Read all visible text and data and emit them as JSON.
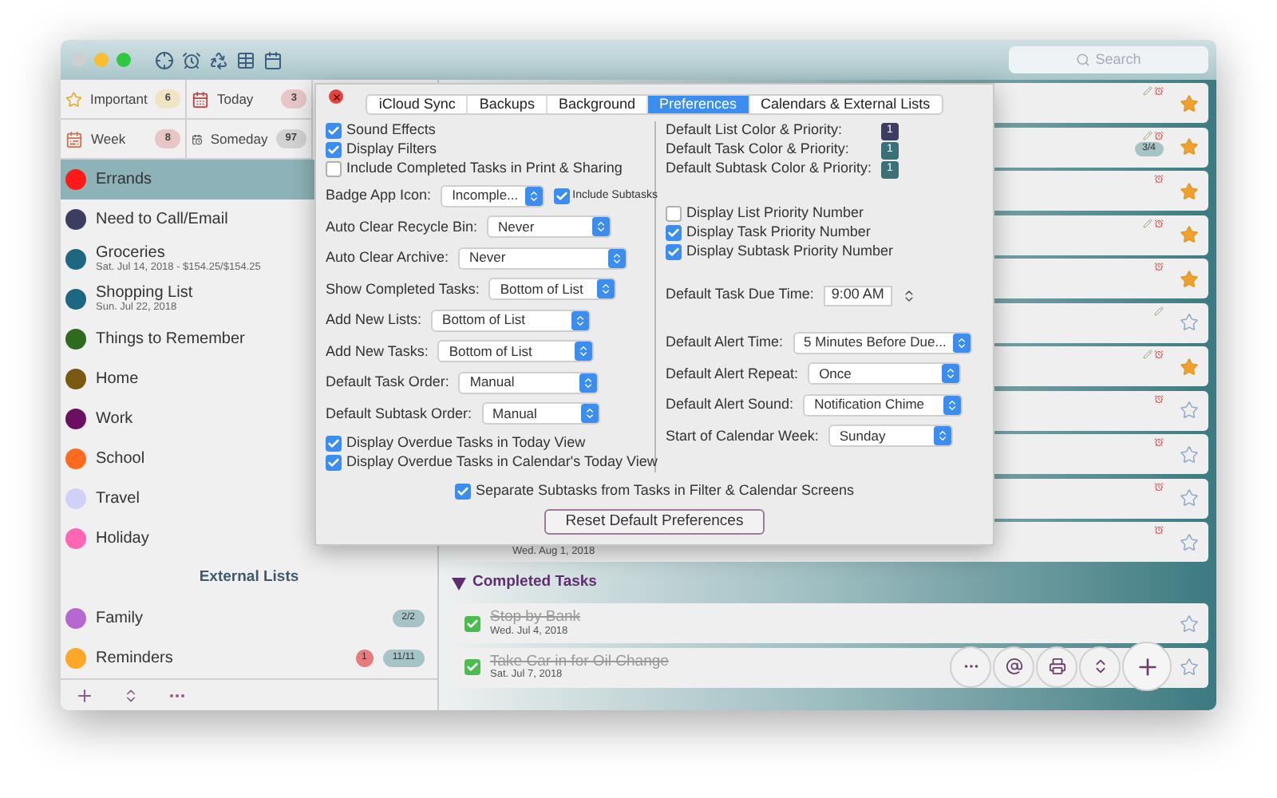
{
  "toolbar": {
    "search": {
      "placeholder": "Search"
    }
  },
  "filters": [
    {
      "label": "Important",
      "count": "6",
      "color": "#efe5c4"
    },
    {
      "label": "Today",
      "count": "3",
      "color": "#e8c6c6"
    },
    {
      "label": "Week",
      "count": "8",
      "color": "#e8c6c6"
    },
    {
      "label": "Someday",
      "count": "97",
      "color": "#d2d2d2"
    }
  ],
  "lists": [
    {
      "name": "Errands",
      "color": "#ff1a1a",
      "selected": true
    },
    {
      "name": "Need to Call/Email",
      "color": "#3d3d63",
      "selected": false
    },
    {
      "name": "Groceries",
      "subtitle": "Sat. Jul 14, 2018 - $154.25/$154.25",
      "color": "#1d6780",
      "selected": false
    },
    {
      "name": "Shopping List",
      "subtitle": "Sun. Jul 22, 2018",
      "color": "#1d6780",
      "selected": false
    },
    {
      "name": "Things to Remember",
      "color": "#2f6b1f",
      "selected": false
    },
    {
      "name": "Home",
      "color": "#7a5a12",
      "selected": false
    },
    {
      "name": "Work",
      "color": "#6b1060",
      "selected": false
    },
    {
      "name": "School",
      "color": "#ff6a20",
      "selected": false
    },
    {
      "name": "Travel",
      "color": "#d0d0f8",
      "selected": false
    },
    {
      "name": "Holiday",
      "color": "#ff66b3",
      "selected": false
    }
  ],
  "external_lists": {
    "heading": "External Lists",
    "items": [
      {
        "name": "Family",
        "color": "#b667d0",
        "progress": "2/2",
        "selected": false
      },
      {
        "name": "Reminders",
        "color": "#ffa726",
        "alert": "1",
        "progress": "11/11",
        "selected": false
      }
    ]
  },
  "tasks": [
    {
      "starred": true,
      "alarm": true,
      "note": true
    },
    {
      "starred": true,
      "alarm": true,
      "note": true,
      "progress": "3/4"
    },
    {
      "starred": true,
      "alarm": true,
      "note": false
    },
    {
      "starred": true,
      "alarm": true,
      "note": true
    },
    {
      "starred": true,
      "alarm": true,
      "note": false
    },
    {
      "starred": false,
      "alarm": false,
      "note": true
    },
    {
      "starred": true,
      "alarm": true,
      "note": true
    },
    {
      "starred": false,
      "alarm": true,
      "note": false
    },
    {
      "starred": false,
      "alarm": true,
      "note": false
    },
    {
      "starred": false,
      "alarm": true,
      "note": false
    },
    {
      "starred": false,
      "alarm": true,
      "note": false,
      "date": "Wed. Aug 1, 2018"
    }
  ],
  "completed": {
    "heading": "Completed Tasks",
    "expanded": true,
    "tasks": [
      {
        "title": "Stop by Bank",
        "date": "Wed. Jul 4, 2018",
        "checked": true,
        "starred": false
      },
      {
        "title": "Take Car in for Oil Change",
        "date": "Sat. Jul 7, 2018",
        "checked": true,
        "starred": false
      }
    ]
  },
  "dialog": {
    "tabs": [
      {
        "label": "iCloud Sync",
        "selected": false
      },
      {
        "label": "Backups",
        "selected": false
      },
      {
        "label": "Background",
        "selected": false
      },
      {
        "label": "Preferences",
        "selected": true
      },
      {
        "label": "Calendars & External Lists",
        "selected": false
      }
    ],
    "left_checks": [
      {
        "label": "Sound Effects",
        "checked": true
      },
      {
        "label": "Display Filters",
        "checked": true
      },
      {
        "label": "Include Completed Tasks in Print & Sharing",
        "checked": false
      }
    ],
    "badge": {
      "label": "Badge App Icon:",
      "value": "Incomple...",
      "option": {
        "label": "Include Subtasks",
        "checked": true
      }
    },
    "left_selects": [
      {
        "label": "Auto Clear Recycle Bin:",
        "value": "Never"
      },
      {
        "label": "Auto Clear Archive:",
        "value": "Never"
      },
      {
        "label": "Show Completed Tasks:",
        "value": "Bottom of List"
      },
      {
        "label": "Add New Lists:",
        "value": "Bottom of List"
      },
      {
        "label": "Add New Tasks:",
        "value": "Bottom of List"
      },
      {
        "label": "Default Task Order:",
        "value": "Manual"
      },
      {
        "label": "Default Subtask Order:",
        "value": "Manual"
      }
    ],
    "overdue_checks": [
      {
        "label": "Display Overdue Tasks in Today View",
        "checked": true
      },
      {
        "label": "Display Overdue Tasks in Calendar's Today View",
        "checked": true
      }
    ],
    "priorities": [
      {
        "label": "Default List Color & Priority:",
        "value": "1",
        "color": "#3d3d63"
      },
      {
        "label": "Default Task Color & Priority:",
        "value": "1",
        "color": "#3a7078"
      },
      {
        "label": "Default Subtask Color & Priority:",
        "value": "1",
        "color": "#3a7078"
      }
    ],
    "right_checks": [
      {
        "label": "Display List Priority Number",
        "checked": false
      },
      {
        "label": "Display Task Priority Number",
        "checked": true
      },
      {
        "label": "Display Subtask Priority Number",
        "checked": true
      }
    ],
    "due_time": {
      "label": "Default Task Due Time:",
      "value": "9:00 AM"
    },
    "right_selects": [
      {
        "label": "Default Alert Time:",
        "value": "5 Minutes Before Due..."
      },
      {
        "label": "Default Alert Repeat:",
        "value": "Once"
      },
      {
        "label": "Default Alert Sound:",
        "value": "Notification Chime"
      },
      {
        "label": "Start of Calendar Week:",
        "value": "Sunday"
      }
    ],
    "separate_check": {
      "label": "Separate Subtasks from Tasks in Filter & Calendar Screens",
      "checked": true
    },
    "reset_button": "Reset Default Preferences"
  }
}
